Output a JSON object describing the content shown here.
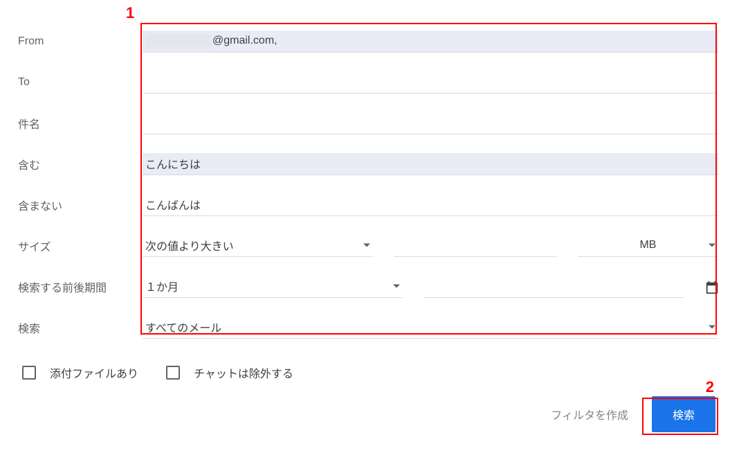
{
  "annotations": {
    "num1": "1",
    "num2": "2"
  },
  "labels": {
    "from": "From",
    "to": "To",
    "subject": "件名",
    "has": "含む",
    "nothas": "含まない",
    "size": "サイズ",
    "date": "検索する前後期間",
    "search_in": "検索"
  },
  "values": {
    "from_suffix": "@gmail.com,",
    "to": "",
    "subject": "",
    "has": "こんにちは",
    "nothas": "こんばんは",
    "size_op": "次の値より大きい",
    "size_val": "",
    "size_unit": "MB",
    "date_range": "１か月",
    "date_value": "",
    "search_in": "すべてのメール"
  },
  "checkboxes": {
    "attachment": "添付ファイルあり",
    "exclude_chat": "チャットは除外する"
  },
  "actions": {
    "create_filter": "フィルタを作成",
    "search": "検索"
  }
}
